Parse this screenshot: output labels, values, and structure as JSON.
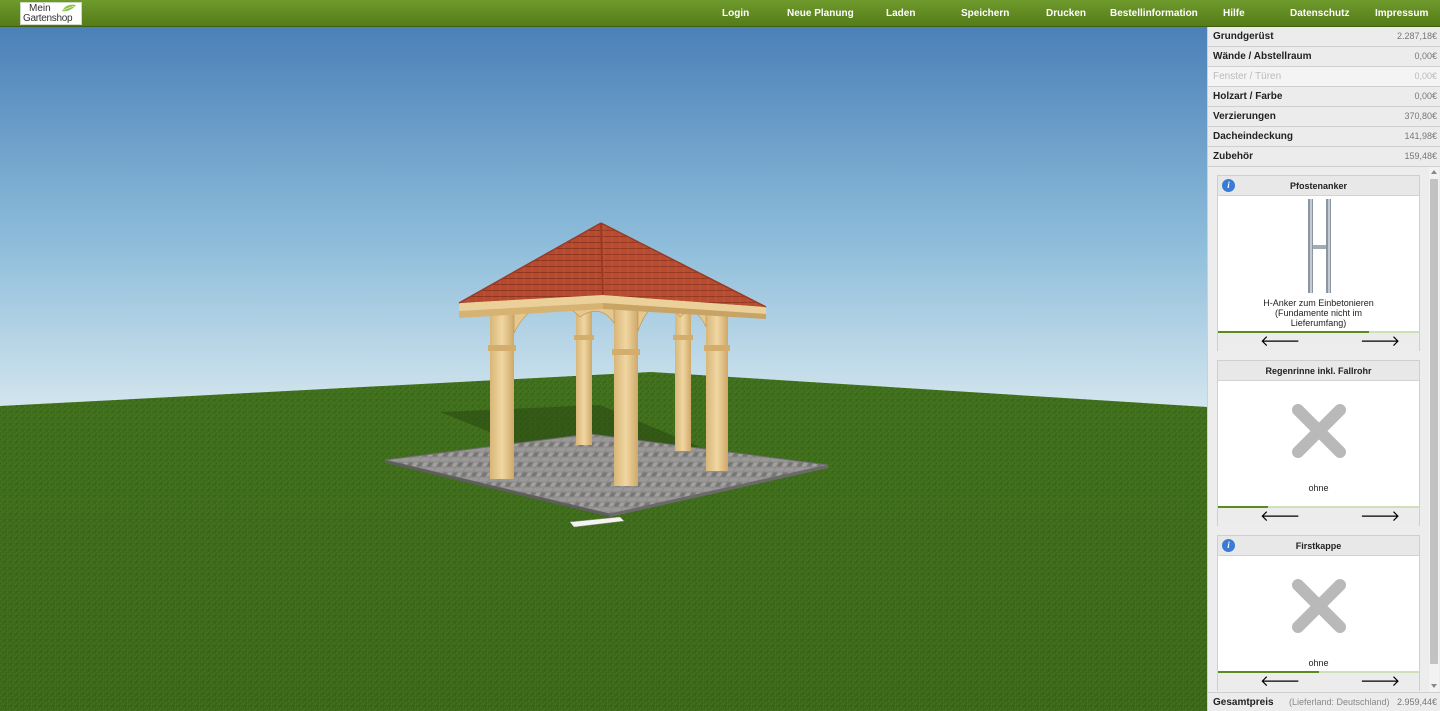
{
  "logo": {
    "line1": "Mein",
    "line2": "Gartenshop"
  },
  "nav": [
    {
      "label": "Login",
      "name": "nav-login"
    },
    {
      "label": "Neue Planung",
      "name": "nav-neue-planung"
    },
    {
      "label": "Laden",
      "name": "nav-laden"
    },
    {
      "label": "Speichern",
      "name": "nav-speichern"
    },
    {
      "label": "Drucken",
      "name": "nav-drucken"
    },
    {
      "label": "Bestellinformation",
      "name": "nav-bestellinformation"
    },
    {
      "label": "Hilfe",
      "name": "nav-hilfe"
    },
    {
      "label": "Datenschutz",
      "name": "nav-datenschutz"
    },
    {
      "label": "Impressum",
      "name": "nav-impressum"
    }
  ],
  "categories": [
    {
      "label": "Grundgerüst",
      "price": "2.287,18€",
      "enabled": true
    },
    {
      "label": "Wände / Abstellraum",
      "price": "0,00€",
      "enabled": true
    },
    {
      "label": "Fenster / Türen",
      "price": "0,00€",
      "enabled": false
    },
    {
      "label": "Holzart / Farbe",
      "price": "0,00€",
      "enabled": true
    },
    {
      "label": "Verzierungen",
      "price": "370,80€",
      "enabled": true
    },
    {
      "label": "Dacheindeckung",
      "price": "141,98€",
      "enabled": true
    },
    {
      "label": "Zubehör",
      "price": "159,48€",
      "enabled": true
    }
  ],
  "items": [
    {
      "title": "Pfostenanker",
      "info": "i",
      "hasInfo": true,
      "image": "h-anchor-icon",
      "desc": [
        "H-Anker zum Einbetonieren",
        "(Fundamente nicht im",
        "Lieferumfang)"
      ],
      "progress": 0.75,
      "prev": "🡐",
      "next": "🡒"
    },
    {
      "title": "Regenrinne inkl. Fallrohr",
      "info": "",
      "hasInfo": false,
      "image": "none-cross-icon",
      "desc": [
        "ohne"
      ],
      "progress": 0.25,
      "prev": "🡐",
      "next": "🡒"
    },
    {
      "title": "Firstkappe",
      "info": "i",
      "hasInfo": true,
      "image": "none-cross-icon",
      "desc": [
        "ohne"
      ],
      "progress": 0.5,
      "prev": "🡐",
      "next": "🡒"
    }
  ],
  "total": {
    "label": "Gesamtpreis",
    "note": "(Lieferland: Deutschland)",
    "value": "2.959,44€"
  },
  "colors": {
    "topbar": "#5f8a21",
    "roof": "#b8452c",
    "wood": "#e8c98e",
    "grass": "#3d6b1a",
    "skyTop": "#4f86bd",
    "skyBottom": "#d4e6ef"
  }
}
